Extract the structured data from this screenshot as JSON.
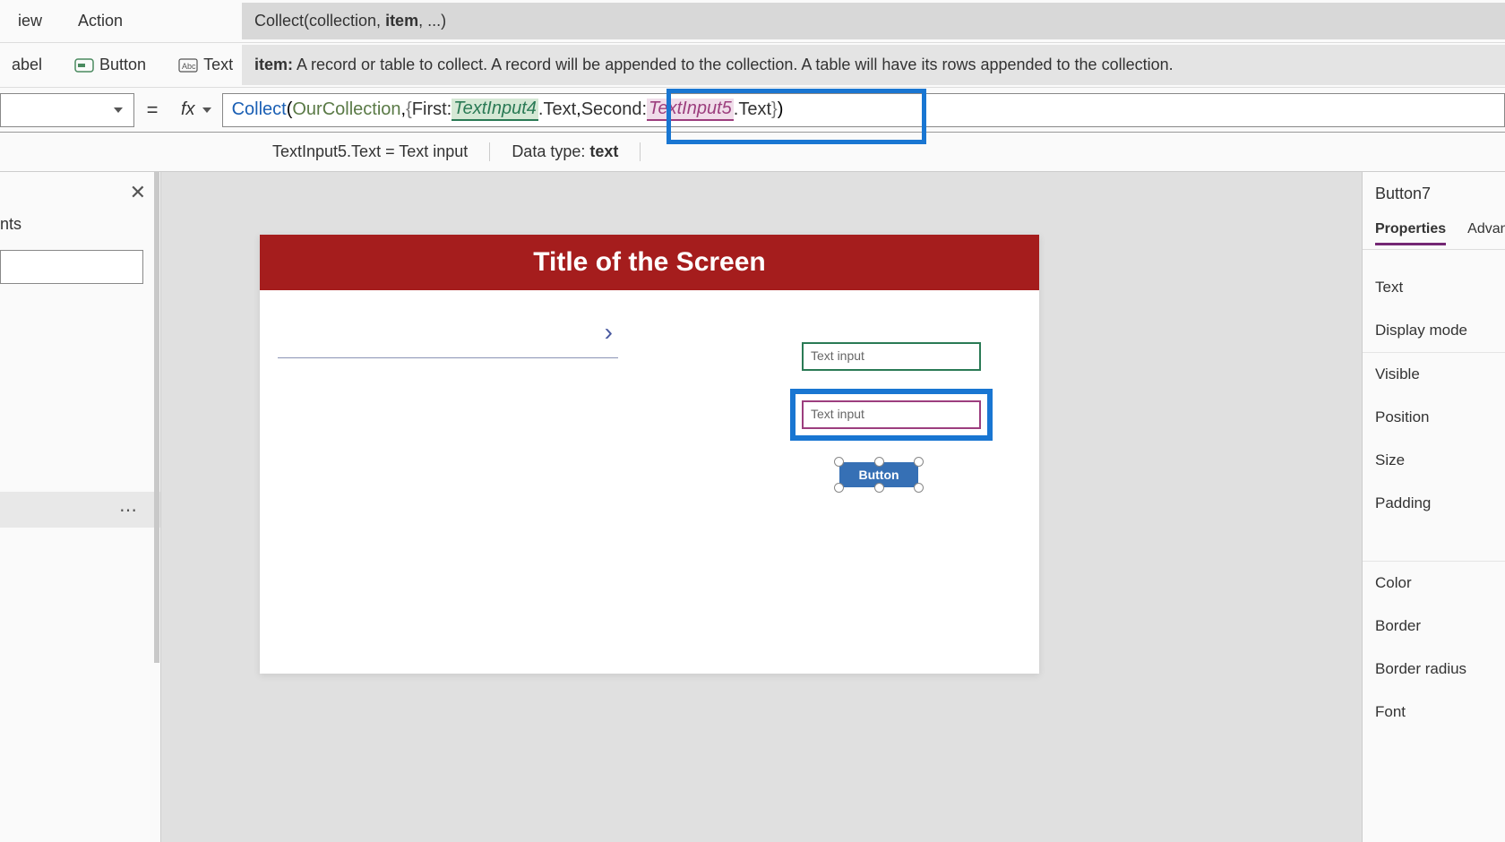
{
  "menu": {
    "view": "iew",
    "action": "Action"
  },
  "formula_hint": {
    "prefix": "Collect(collection, ",
    "bold": "item",
    "suffix": ", ...)"
  },
  "toolbar": {
    "label_btn": "abel",
    "button_btn": "Button",
    "text_btn": "Text"
  },
  "description": {
    "bold": "item:",
    "text": " A record or table to collect. A record will be appended to the collection. A table will have its rows appended to the collection."
  },
  "formula_bar": {
    "eq": "=",
    "fx": "fx",
    "fn_name": "Collect",
    "open_paren": "(",
    "collection": "OurCollection",
    "comma1": ", ",
    "open_brace": "{",
    "key1": "First: ",
    "ref1": "TextInput4",
    "dot_text1": ".Text",
    "comma2": ",",
    "space": " ",
    "key2": "Second: ",
    "ref2": "TextInput5",
    "dot_text2": ".Text",
    "close_brace": "}",
    "close_paren": ")"
  },
  "info_bar": {
    "seg1": "TextInput5.Text  =  Text input",
    "seg2_label": "Data type: ",
    "seg2_value": "text"
  },
  "tree": {
    "title": "nts",
    "close": "✕",
    "dots": "⋯"
  },
  "canvas": {
    "title": "Title of the Screen",
    "nav_arrow": "›",
    "text_input1_placeholder": "Text input",
    "text_input2_placeholder": "Text input",
    "button_label": "Button"
  },
  "properties": {
    "selected": "Button7",
    "tab_props": "Properties",
    "tab_adv": "Advan",
    "rows": {
      "text": "Text",
      "display_mode": "Display mode",
      "visible": "Visible",
      "position": "Position",
      "size": "Size",
      "padding": "Padding",
      "color": "Color",
      "border": "Border",
      "border_radius": "Border radius",
      "font": "Font"
    }
  }
}
